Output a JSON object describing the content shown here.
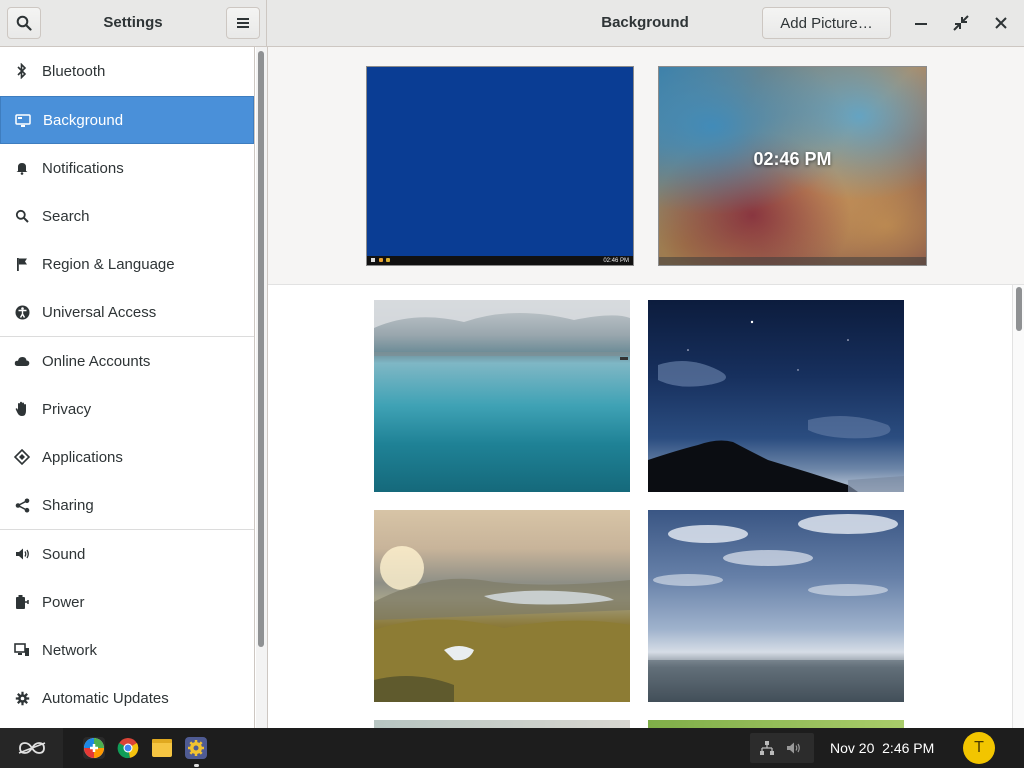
{
  "header": {
    "sidebar_title": "Settings",
    "page_title": "Background",
    "add_picture_label": "Add Picture…"
  },
  "sidebar": {
    "items": [
      {
        "label": "Bluetooth",
        "icon": "bluetooth-icon"
      },
      {
        "label": "Background",
        "icon": "display-icon",
        "active": true
      },
      {
        "label": "Notifications",
        "icon": "bell-icon"
      },
      {
        "label": "Search",
        "icon": "search-icon"
      },
      {
        "label": "Region & Language",
        "icon": "flag-icon"
      },
      {
        "label": "Universal Access",
        "icon": "accessibility-icon"
      },
      {
        "label": "Online Accounts",
        "icon": "cloud-icon"
      },
      {
        "label": "Privacy",
        "icon": "hand-icon"
      },
      {
        "label": "Applications",
        "icon": "applications-icon"
      },
      {
        "label": "Sharing",
        "icon": "share-icon"
      },
      {
        "label": "Sound",
        "icon": "speaker-icon"
      },
      {
        "label": "Power",
        "icon": "battery-icon"
      },
      {
        "label": "Network",
        "icon": "network-icon"
      },
      {
        "label": "Automatic Updates",
        "icon": "gear-icon"
      }
    ]
  },
  "previews": {
    "desktop_time": "02:46 PM",
    "lock_time": "02:46 PM"
  },
  "taskbar": {
    "date": "Nov 20",
    "time": "2:46 PM",
    "avatar_initial": "T",
    "apps": [
      "app-center-icon",
      "chrome-icon",
      "files-icon",
      "settings-icon"
    ]
  },
  "colors": {
    "accent": "#4a90d9",
    "header_bg": "#e8e8e7",
    "taskbar_bg": "#1d1d1d",
    "avatar": "#f2c500"
  }
}
